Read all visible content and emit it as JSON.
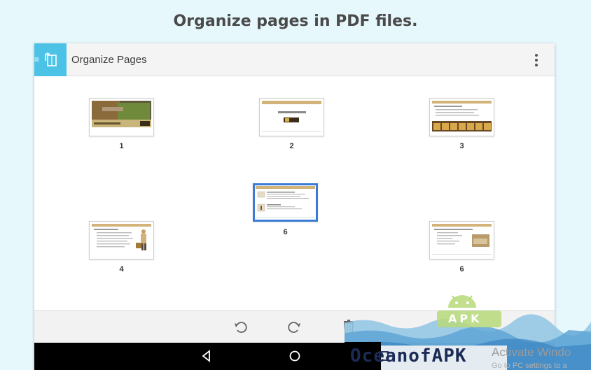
{
  "hero": {
    "title": "Organize pages in PDF files."
  },
  "appbar": {
    "title": "Organize Pages",
    "menu_icon": "hamburger-icon",
    "doc_icon": "document-pages-icon",
    "more_icon": "more-vert-icon"
  },
  "pages": [
    {
      "label": "1",
      "thumb_text": "Bonifacio Supplies: Business Plan 20XX",
      "style": "photo"
    },
    {
      "label": "2",
      "thumb_text": "Executive Summary",
      "style": "summary"
    },
    {
      "label": "3",
      "thumb_text": "About Bonifacio Supplies, Inc.",
      "style": "boxes"
    },
    {
      "label": "6",
      "thumb_text": "Bonifacio Supplies",
      "style": "selected"
    },
    {
      "label": "4",
      "thumb_text": "Bonifacio Supplies goals",
      "style": "person"
    },
    {
      "label": "6",
      "thumb_text": "New products and services under development",
      "style": "products"
    }
  ],
  "toolbar": {
    "rotate_left_icon": "rotate-left-icon",
    "rotate_right_icon": "rotate-right-icon",
    "delete_icon": "trash-icon"
  },
  "sysnav": {
    "back_icon": "back-icon",
    "home_icon": "home-icon",
    "recents_icon": "recents-icon"
  },
  "watermark": {
    "brand": "OceanofAPK",
    "badge": "APK",
    "activate": "Activate Windo",
    "activate_sub": "Go to PC settings to a"
  },
  "colors": {
    "accent": "#4cc3e6",
    "selection": "#3b7bd6",
    "background": "#e6f8fc"
  }
}
